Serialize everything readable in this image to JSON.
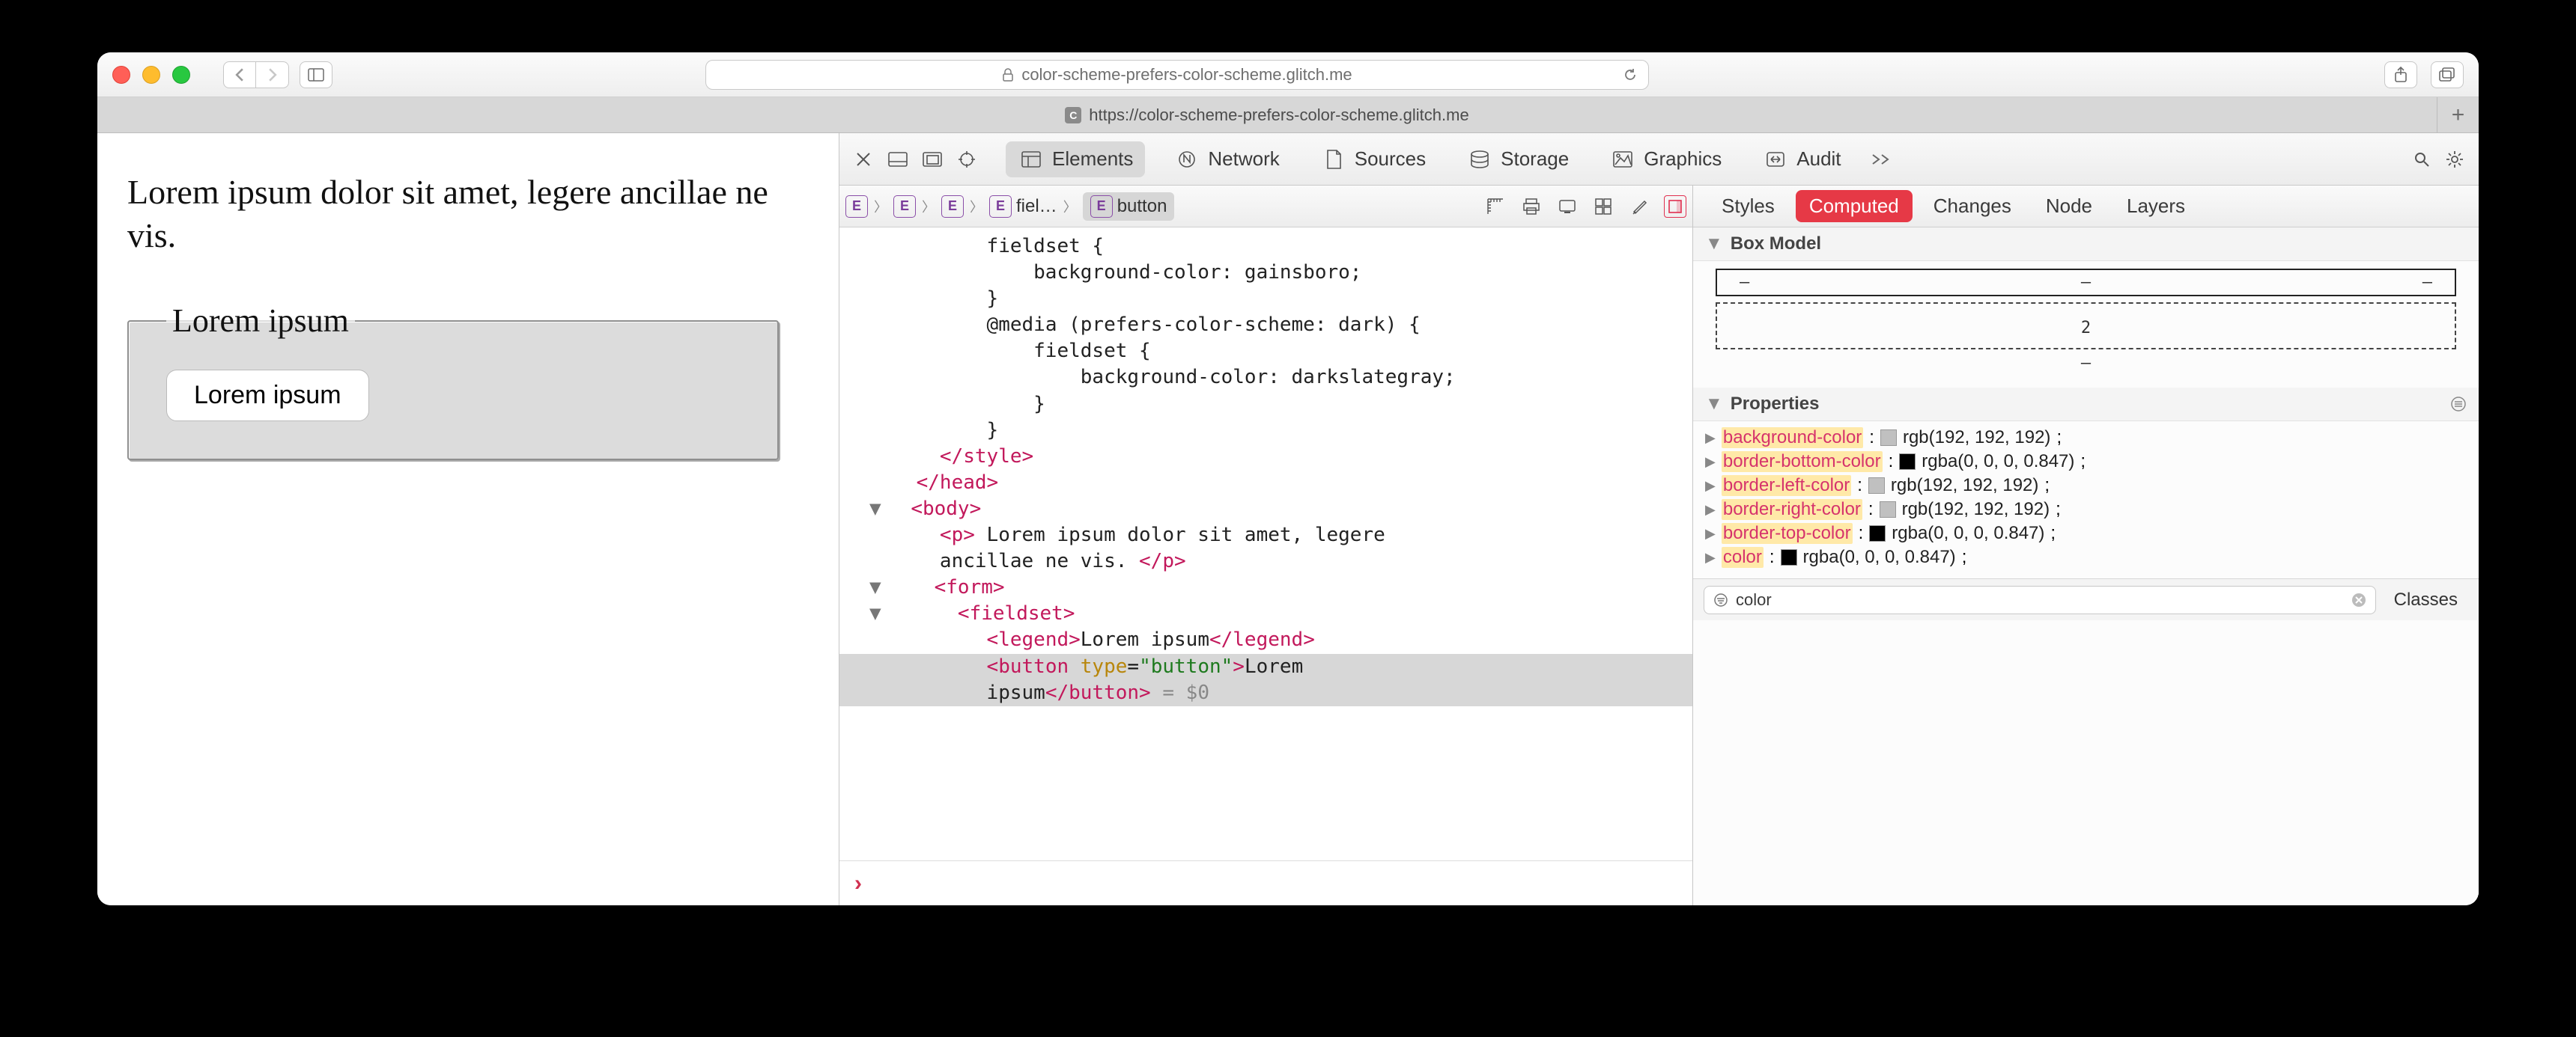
{
  "browser": {
    "url_display": "color-scheme-prefers-color-scheme.glitch.me",
    "tab_title": "https://color-scheme-prefers-color-scheme.glitch.me",
    "tab_favicon_letter": "C"
  },
  "page": {
    "paragraph": "Lorem ipsum dolor sit amet, legere ancillae ne vis.",
    "legend": "Lorem ipsum",
    "button_label": "Lorem ipsum"
  },
  "devtools": {
    "panels": [
      "Elements",
      "Network",
      "Sources",
      "Storage",
      "Graphics",
      "Audit"
    ],
    "active_panel": "Elements",
    "breadcrumb": [
      {
        "badge": "E",
        "label": ""
      },
      {
        "badge": "E",
        "label": ""
      },
      {
        "badge": "E",
        "label": ""
      },
      {
        "badge": "E",
        "label": "fiel…"
      },
      {
        "badge": "E",
        "label": "button"
      }
    ],
    "dom_lines": [
      {
        "i": 10,
        "html": "fieldset {"
      },
      {
        "i": 12,
        "html": "  background-color: gainsboro;"
      },
      {
        "i": 10,
        "html": "}"
      },
      {
        "i": 10,
        "html": "@media (prefers-color-scheme: dark) {"
      },
      {
        "i": 12,
        "html": "  fieldset {"
      },
      {
        "i": 14,
        "html": "    background-color: darkslategray;"
      },
      {
        "i": 12,
        "html": "  }"
      },
      {
        "i": 10,
        "html": "}"
      },
      {
        "i": 6,
        "tag": "</style>"
      },
      {
        "i": 4,
        "tag": "</head>"
      },
      {
        "i": 4,
        "disc": "▼",
        "tag": "<body>"
      },
      {
        "i": 6,
        "tag_open": "<p>",
        "text": " Lorem ipsum dolor sit amet, legere"
      },
      {
        "i": 6,
        "text": "ancillae ne vis. ",
        "tag_close": "</p>"
      },
      {
        "i": 6,
        "disc": "▼",
        "tag": "<form>"
      },
      {
        "i": 8,
        "disc": "▼",
        "tag": "<fieldset>"
      },
      {
        "i": 10,
        "tag_open": "<legend>",
        "text": "Lorem ipsum",
        "tag_close": "</legend>"
      }
    ],
    "dom_selected": {
      "i": 10,
      "open": "<button ",
      "attr": "type",
      "val": "\"button\"",
      "open2": ">",
      "text": "Lorem ipsum",
      "close": "</button>",
      "suffix": " = $0"
    },
    "styles_tabs": [
      "Styles",
      "Computed",
      "Changes",
      "Node",
      "Layers"
    ],
    "styles_active": "Computed",
    "box_model_label": "Box Model",
    "box_model_values": {
      "row": [
        "–",
        "–",
        "–"
      ],
      "bottom": "2",
      "outer_bottom": "–"
    },
    "properties_label": "Properties",
    "properties": [
      {
        "name": "background-color",
        "swatch": "light",
        "value": "rgb(192, 192, 192)"
      },
      {
        "name": "border-bottom-color",
        "swatch": "black",
        "value": "rgba(0, 0, 0, 0.847)"
      },
      {
        "name": "border-left-color",
        "swatch": "light",
        "value": "rgb(192, 192, 192)"
      },
      {
        "name": "border-right-color",
        "swatch": "light",
        "value": "rgb(192, 192, 192)"
      },
      {
        "name": "border-top-color",
        "swatch": "black",
        "value": "rgba(0, 0, 0, 0.847)"
      },
      {
        "name": "color",
        "swatch": "black",
        "value": "rgba(0, 0, 0, 0.847)"
      }
    ],
    "filter_value": "color",
    "classes_label": "Classes"
  }
}
